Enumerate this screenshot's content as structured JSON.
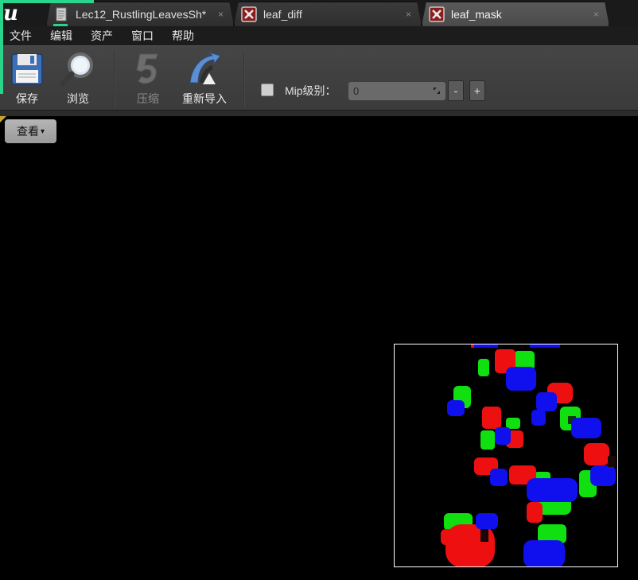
{
  "tabs": [
    {
      "label": "Lec12_RustlingLeavesSh*",
      "icon": "document-icon",
      "close": "×"
    },
    {
      "label": "leaf_diff",
      "icon": "texture-icon",
      "close": "×"
    },
    {
      "label": "leaf_mask",
      "icon": "texture-icon",
      "close": "×",
      "active": true
    }
  ],
  "logo": "u",
  "menu": [
    "文件",
    "编辑",
    "资产",
    "窗口",
    "帮助"
  ],
  "toolbar": {
    "save_label": "保存",
    "browse_label": "浏览",
    "compress_label": "压缩",
    "reimport_label": "重新导入",
    "mip_label": "Mip级别：",
    "mip_value": "0",
    "minus_label": "-",
    "plus_label": "+"
  },
  "viewport": {
    "view_label": "查看",
    "view_caret": "▾"
  },
  "colors": {
    "accent": "#2ad48a",
    "toolbar": "#404040",
    "background": "#000000"
  }
}
